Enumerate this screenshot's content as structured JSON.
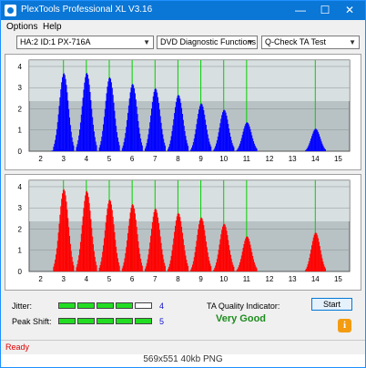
{
  "window": {
    "title": "PlexTools Professional XL V3.16"
  },
  "titlebar_buttons": {
    "minimize": "—",
    "maximize": "☐",
    "close": "✕"
  },
  "menu": {
    "options": "Options",
    "help": "Help"
  },
  "toolbar": {
    "drive": "HA:2 ID:1  PX-716A",
    "function": "DVD Diagnostic Functions",
    "test": "Q-Check TA Test"
  },
  "charts_x_ticks": [
    "2",
    "3",
    "4",
    "5",
    "6",
    "7",
    "8",
    "9",
    "10",
    "11",
    "12",
    "13",
    "14",
    "15"
  ],
  "charts_y_ticks": [
    "4",
    "3",
    "2",
    "1",
    "0"
  ],
  "chart_data": [
    {
      "type": "histogram",
      "title": "",
      "color": "#0000ff",
      "xlim": [
        1.5,
        15.5
      ],
      "ylim": [
        0,
        4.3
      ],
      "grid_lines_at": [
        3,
        4,
        5,
        6,
        7,
        8,
        9,
        10,
        11,
        14
      ],
      "series": [
        {
          "values": [
            [
              2.8,
              0.1
            ],
            [
              3.0,
              3.7
            ],
            [
              4.0,
              3.7
            ],
            [
              5.0,
              3.5
            ],
            [
              6.0,
              3.2
            ],
            [
              7.0,
              3.0
            ],
            [
              8.0,
              2.7
            ],
            [
              9.0,
              2.3
            ],
            [
              10.0,
              2.0
            ],
            [
              11.0,
              1.4
            ],
            [
              14.0,
              1.1
            ]
          ]
        }
      ]
    },
    {
      "type": "histogram",
      "title": "",
      "color": "#ff0000",
      "xlim": [
        1.5,
        15.5
      ],
      "ylim": [
        0,
        4.3
      ],
      "grid_lines_at": [
        3,
        4,
        5,
        6,
        7,
        8,
        9,
        10,
        11,
        14
      ],
      "series": [
        {
          "values": [
            [
              3.0,
              3.9
            ],
            [
              4.0,
              3.8
            ],
            [
              5.0,
              3.4
            ],
            [
              6.0,
              3.2
            ],
            [
              7.0,
              3.0
            ],
            [
              8.0,
              2.8
            ],
            [
              9.0,
              2.6
            ],
            [
              10.0,
              2.3
            ],
            [
              11.0,
              1.7
            ],
            [
              14.0,
              1.9
            ]
          ]
        }
      ]
    }
  ],
  "bottom": {
    "jitter_label": "Jitter:",
    "jitter_value": "4",
    "jitter_level": 4,
    "peak_label": "Peak Shift:",
    "peak_value": "5",
    "peak_level": 5,
    "ta_label": "TA Quality Indicator:",
    "ta_value": "Very Good",
    "start_label": "Start",
    "info_label": "i"
  },
  "status": "Ready",
  "footer": "569x551  40kb  PNG"
}
